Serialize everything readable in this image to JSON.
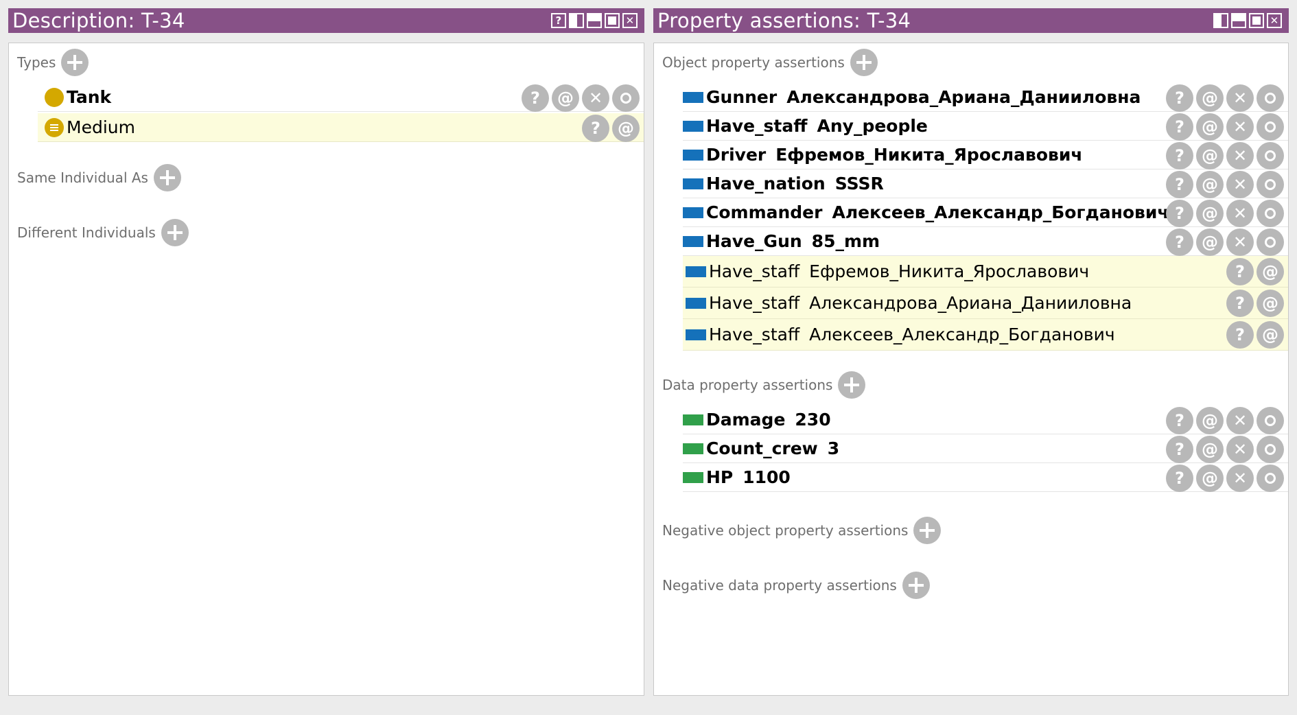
{
  "left_view": {
    "title": "Description: T-34",
    "title_buttons": [
      "help-icon",
      "split-vertical-icon",
      "split-horizontal-icon",
      "maximize-icon",
      "close-icon"
    ],
    "types_label": "Types",
    "types": [
      {
        "label": "Tank",
        "inferred": false,
        "icon": "class-icon"
      },
      {
        "label": "Medium",
        "inferred": true,
        "icon": "equivalent-class-icon"
      }
    ],
    "same_individual_label": "Same Individual As",
    "different_individuals_label": "Different Individuals"
  },
  "right_view": {
    "title": "Property assertions: T-34",
    "title_buttons": [
      "split-vertical-icon",
      "split-horizontal-icon",
      "maximize-icon",
      "close-icon"
    ],
    "object_label": "Object property assertions",
    "object_assertions": [
      {
        "property": "Gunner",
        "value": "Александрова_Ариана_Данииловна",
        "inferred": false
      },
      {
        "property": "Have_staff",
        "value": "Any_people",
        "inferred": false
      },
      {
        "property": "Driver",
        "value": "Ефремов_Никита_Ярославович",
        "inferred": false
      },
      {
        "property": "Have_nation",
        "value": "SSSR",
        "inferred": false
      },
      {
        "property": "Commander",
        "value": "Алексеев_Александр_Богданович",
        "inferred": false
      },
      {
        "property": "Have_Gun",
        "value": "85_mm",
        "inferred": false
      },
      {
        "property": "Have_staff",
        "value": "Ефремов_Никита_Ярославович",
        "inferred": true
      },
      {
        "property": "Have_staff",
        "value": "Александрова_Ариана_Данииловна",
        "inferred": true
      },
      {
        "property": "Have_staff",
        "value": "Алексеев_Александр_Богданович",
        "inferred": true
      }
    ],
    "data_label": "Data property assertions",
    "data_assertions": [
      {
        "property": "Damage",
        "value": "230"
      },
      {
        "property": "Count_crew",
        "value": "3"
      },
      {
        "property": "HP",
        "value": "1100"
      }
    ],
    "negative_object_label": "Negative object property assertions",
    "negative_data_label": "Negative data property assertions"
  },
  "colors": {
    "titlebar": "#875187",
    "object_property": "#1571ba",
    "data_property": "#30a04a",
    "class": "#d4a800",
    "inferred_background": "#fcfcdc"
  }
}
